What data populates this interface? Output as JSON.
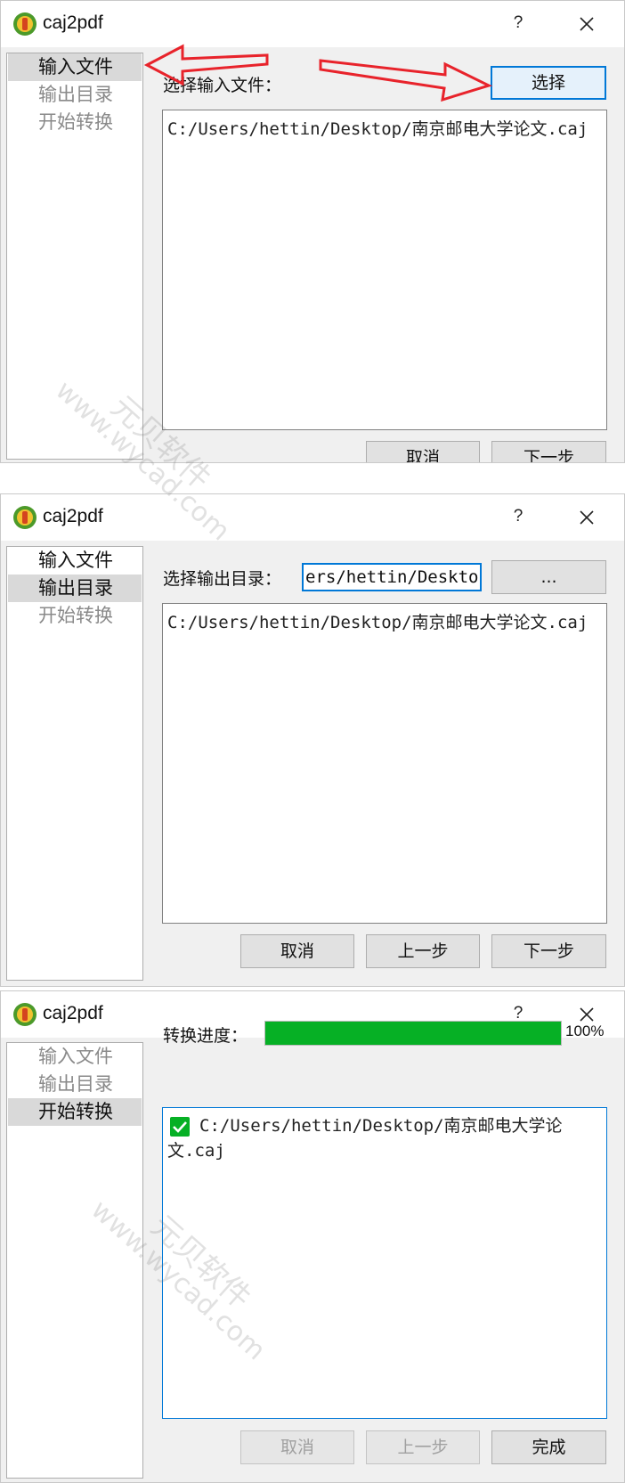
{
  "app": {
    "title": "caj2pdf",
    "help": "?"
  },
  "steps": [
    "输入文件",
    "输出目录",
    "开始转换"
  ],
  "screen1": {
    "label": "选择输入文件：",
    "choose_button": "选择",
    "files": [
      "C:/Users/hettin/Desktop/南京邮电大学论文.caj"
    ],
    "cancel_button": "取消",
    "next_button": "下一步"
  },
  "screen2": {
    "label": "选择输出目录：",
    "output_path": "ers/hettin/Desktop",
    "browse_button": "...",
    "files": [
      "C:/Users/hettin/Desktop/南京邮电大学论文.caj"
    ],
    "cancel_button": "取消",
    "prev_button": "上一步",
    "next_button": "下一步"
  },
  "screen3": {
    "label": "转换进度：",
    "progress": 1.0,
    "progress_text": "100%",
    "converted_files": [
      "C:/Users/hettin/Desktop/南京邮电大学论文.caj"
    ],
    "cancel_button": "取消",
    "prev_button": "上一步",
    "finish_button": "完成"
  },
  "watermark": {
    "brand": "元贝软件",
    "url": "www.wycad.com"
  },
  "colors": {
    "accent": "#0078d7",
    "progress": "#06b025",
    "arrow": "#e8232b"
  }
}
